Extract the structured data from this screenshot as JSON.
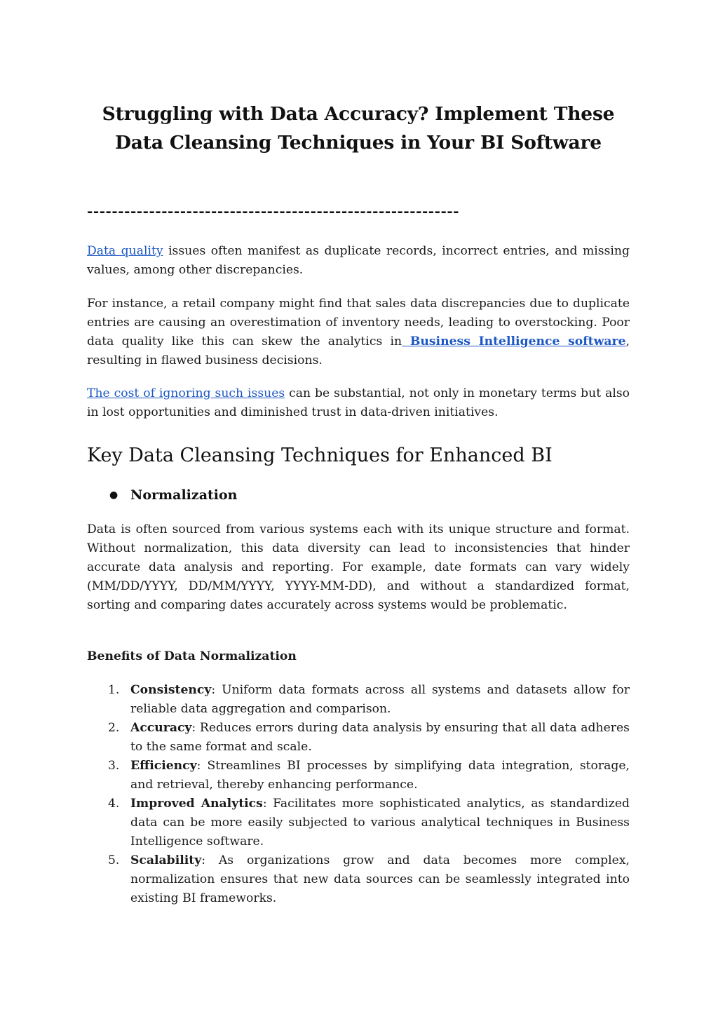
{
  "document": {
    "title": "Struggling with Data Accuracy? Implement These Data Cleansing Techniques in Your BI Software",
    "divider": "------------------------------------------------------------",
    "paragraphs": {
      "p1": {
        "link": "Data quality",
        "text": " issues often manifest as duplicate records, incorrect entries, and missing values, among other discrepancies."
      },
      "p2": {
        "text_before": "For instance, a retail company might find that sales data discrepancies due to duplicate entries are causing an overestimation of inventory needs, leading to overstocking. Poor data quality like this can skew the analytics in",
        "link": " Business Intelligence software",
        "text_after": ", resulting in flawed business decisions."
      },
      "p3": {
        "link": "The cost of ignoring such issues",
        "text": " can be substantial, not only in monetary terms but also in lost opportunities and diminished trust in data-driven initiatives."
      },
      "p4": {
        "text": "Data is often sourced from various systems each with its unique structure and format. Without normalization, this data diversity can lead to inconsistencies that hinder accurate data analysis and reporting. For example, date formats can vary widely (MM/DD/YYYY, DD/MM/YYYY, YYYY-MM-DD), and without a standardized format, sorting and comparing dates accurately across systems would be problematic."
      }
    },
    "section_heading": "Key Data Cleansing Techniques for Enhanced BI",
    "bullet": {
      "symbol": "●",
      "label": "Normalization"
    },
    "benefits_heading": "Benefits of Data Normalization",
    "benefits": [
      {
        "num": "1.",
        "term": "Consistency",
        "desc": ": Uniform data formats across all systems and datasets allow for reliable data aggregation and comparison."
      },
      {
        "num": "2.",
        "term": "Accuracy",
        "desc": ": Reduces errors during data analysis by ensuring that all data adheres to the same format and scale."
      },
      {
        "num": "3.",
        "term": "Efficiency",
        "desc": ": Streamlines BI processes by simplifying data integration, storage, and retrieval, thereby enhancing performance."
      },
      {
        "num": "4.",
        "term": "Improved Analytics",
        "desc": ": Facilitates more sophisticated analytics, as standardized data can be more easily subjected to various analytical techniques in Business Intelligence software."
      },
      {
        "num": "5.",
        "term": "Scalability",
        "desc": ": As organizations grow and data becomes more complex, normalization ensures that new data sources can be seamlessly integrated into existing BI frameworks."
      }
    ],
    "colors": {
      "link": "#1c57c4",
      "text": "#1a1a1a"
    }
  }
}
